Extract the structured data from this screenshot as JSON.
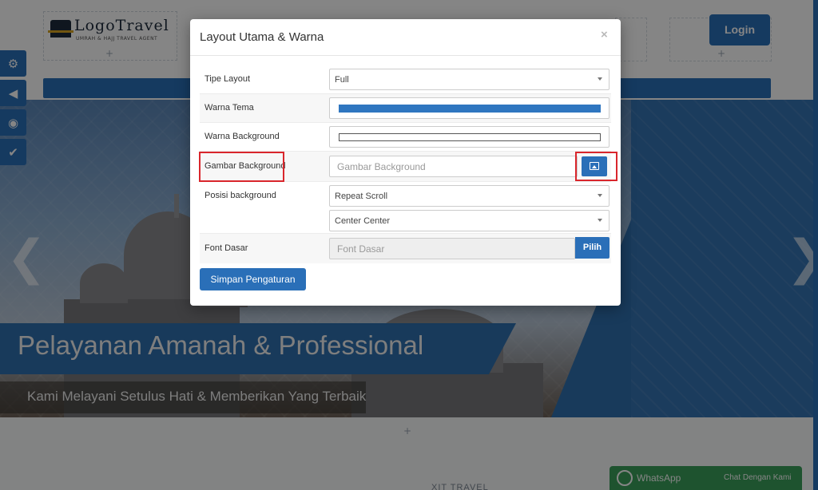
{
  "site": {
    "logo_main": "LogoTravel",
    "logo_sub": "UMRAH & HAJJ TRAVEL AGENT",
    "login_label": "Login",
    "slogan": "Pelayanan Amanah & Professional",
    "subslogan": "Kami Melayani Setulus Hati & Memberikan Yang Terbaik",
    "footer_partial": "XIT TRAVEL",
    "whatsapp_label": "WhatsApp",
    "whatsapp_chat": "Chat Dengan Kami",
    "slider_prev": "❮",
    "slider_next": "❯"
  },
  "toolbar": {
    "icons": [
      "gears-icon",
      "backward-icon",
      "eye-icon",
      "check-icon"
    ]
  },
  "modal": {
    "title": "Layout Utama & Warna",
    "close": "×",
    "fields": {
      "tipe_layout": {
        "label": "Tipe Layout",
        "value": "Full"
      },
      "warna_tema": {
        "label": "Warna Tema",
        "color": "#2f76c0"
      },
      "warna_background": {
        "label": "Warna Background",
        "color": "#ffffff"
      },
      "gambar_background": {
        "label": "Gambar Background",
        "placeholder": "Gambar Background"
      },
      "posisi_background": {
        "label": "Posisi background",
        "repeat_value": "Repeat Scroll",
        "position_value": "Center Center"
      },
      "font_dasar": {
        "label": "Font Dasar",
        "placeholder": "Font Dasar",
        "button": "Pilih"
      }
    },
    "save_button": "Simpan Pengaturan"
  },
  "colors": {
    "accent": "#2a6fb8",
    "highlight": "#d9262c",
    "whatsapp": "#3a9f5a"
  }
}
